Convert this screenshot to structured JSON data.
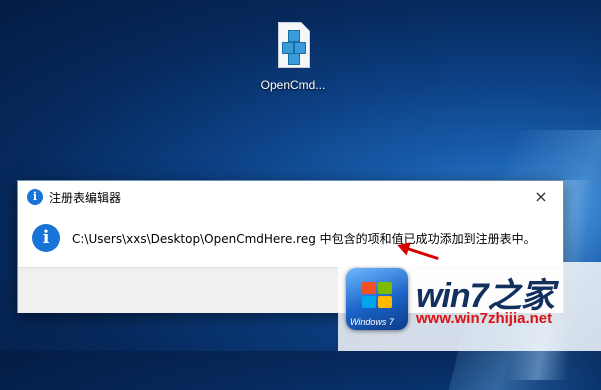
{
  "desktop": {
    "icon_label": "OpenCmd...",
    "icon_name": "registry-file-icon"
  },
  "dialog": {
    "title": "注册表编辑器",
    "close_glyph": "×",
    "message": "C:\\Users\\xxs\\Desktop\\OpenCmdHere.reg 中包含的项和值已成功添加到注册表中。",
    "icon": "info-icon",
    "info_glyph": "i"
  },
  "watermark": {
    "brand": "win7之家",
    "url": "www.win7zhijia.net",
    "logo_text": "Windows 7"
  },
  "colors": {
    "info_blue": "#1a73d6",
    "arrow_red": "#d90000",
    "url_red": "#dd1111"
  }
}
